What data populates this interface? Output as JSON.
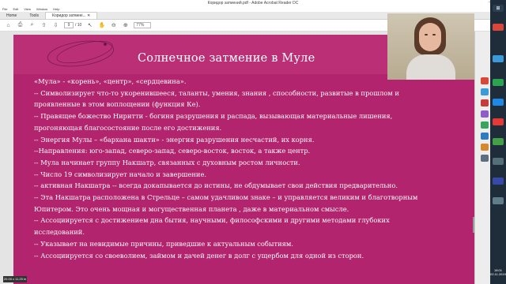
{
  "window": {
    "title": "Коридор затмений.pdf - Adobe Acrobat Reader DC",
    "controls": [
      "–",
      "□",
      "✕"
    ]
  },
  "menu": [
    "File",
    "Edit",
    "View",
    "Window",
    "Help"
  ],
  "tabs": {
    "home": "Home",
    "tools": "Tools",
    "document": "Коридор затмені...  ✕"
  },
  "toolbar": {
    "page_current": "9",
    "page_total": "/ 10",
    "zoom": "77%"
  },
  "slide": {
    "title": "Солнечное затмение  в Муле",
    "lines": [
      " «Мула» - «корень», «центр», «сердцевина».",
      "--  Символизирует что-то укоренившееся,  таланты, умения, знания , способности, развитые в прошлом и",
      "     проявленные в этом воплощении (функция Ке).",
      "-- Правящее божество Ниритти - богиня разрушения и распада, вызывающая материальные лишения,",
      "прогоняющая благосостояние после его достижения.",
      "-- Энергия Мулы – «бархана шакти» - энергия разрушения несчастий, их корня.",
      "--Направления: юго-запад, северо-запад, северо-восток, восток, а также центр.",
      "-- Мула начинает группу Накшатр, связанных с духовным ростом личности.",
      "-- Число 19 символизирует начало и завершение.",
      "-- активная Накшатра -- всегда докапывается до истины, не обдумывает свои действия предварительно.",
      "-- Эта Накшатра расположена в Стрельце – самом удачливом знаке – и управляется великим и благотворным",
      "Юпитером. Это очень мощная и могущественная планета , даже в материальном смысле.",
      "-- Ассоциируется с достижением дна бытия, научными, философскими и другими методами глубоких",
      "исследований.",
      "-- Указывает на невидимые причины, приведшие к актуальным событиям.",
      "-- Ассоциируется со своеволием,  займом и дачей денег в долг с ущербом для одной из сторон."
    ]
  },
  "status": {
    "dimensions": "20.00 x 11.25 in"
  },
  "clock": {
    "time": "18:01",
    "date": "02.11.2019"
  },
  "colors": {
    "slide_bg": "#b2246d",
    "header_bg": "#bb2f77",
    "text": "#ffffff"
  },
  "icons": {
    "home": "home-icon",
    "print": "print-icon",
    "search": "search-icon",
    "prev_page": "arrow-up-icon",
    "next_page": "arrow-down-icon",
    "cursor": "cursor-icon",
    "hand": "hand-icon",
    "zoom_out": "zoom-out-icon",
    "zoom_in": "zoom-in-icon"
  }
}
